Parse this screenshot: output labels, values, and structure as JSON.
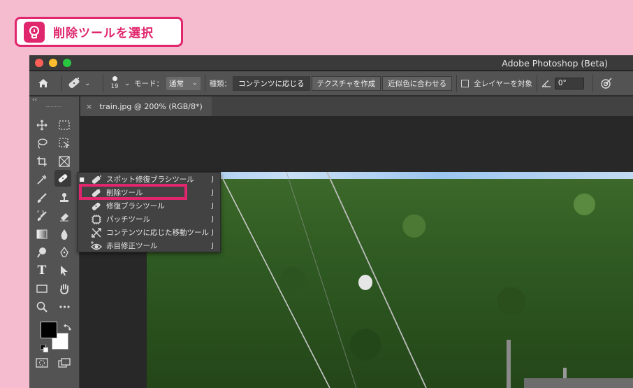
{
  "callout": {
    "title": "削除ツールを選択"
  },
  "window": {
    "title": "Adobe Photoshop (Beta)"
  },
  "options_bar": {
    "brush_size": "19",
    "mode_label": "モード：",
    "mode_value": "通常",
    "type_label": "種類：",
    "type_options": [
      "コンテンツに応じる",
      "テクスチャを作成",
      "近似色に合わせる"
    ],
    "sample_all_label": "全レイヤーを対象",
    "angle_value": "0°"
  },
  "document_tab": {
    "close": "×",
    "title": "train.jpg @ 200% (RGB/8*)"
  },
  "toolbar": {
    "collapse": "‹‹",
    "type_tool": "T",
    "more_tools": "•••"
  },
  "flyout_menu": {
    "items": [
      {
        "label": "スポット修復ブラシツール",
        "shortcut": "J",
        "bullet": "■"
      },
      {
        "label": "削除ツール",
        "shortcut": "J",
        "bullet": ""
      },
      {
        "label": "修復ブラシツール",
        "shortcut": "J",
        "bullet": ""
      },
      {
        "label": "パッチツール",
        "shortcut": "J",
        "bullet": ""
      },
      {
        "label": "コンテンツに応じた移動ツール",
        "shortcut": "J",
        "bullet": ""
      },
      {
        "label": "赤目修正ツール",
        "shortcut": "J",
        "bullet": ""
      }
    ]
  },
  "colors": {
    "accent": "#e0266d",
    "background": "#f5bcd0"
  }
}
